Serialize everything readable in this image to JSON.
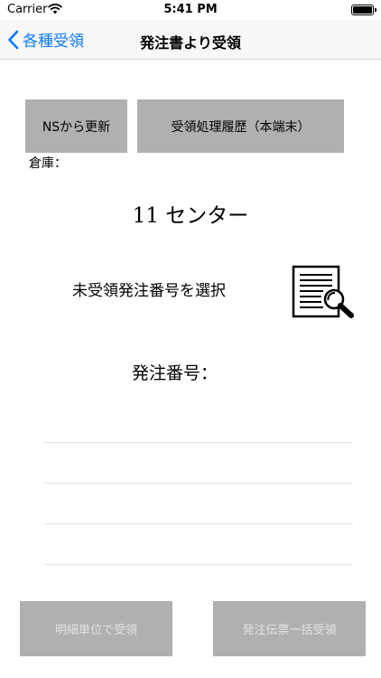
{
  "status": {
    "carrier": "Carrier",
    "time": "5:41 PM"
  },
  "nav": {
    "back_label": "各種受領",
    "title": "発注書より受領"
  },
  "actions": {
    "ns_update": "NSから更新",
    "history": "受領処理履歴（本端末）"
  },
  "warehouse": {
    "label": "倉庫：",
    "value": "11 センター"
  },
  "select_order": {
    "label": "未受領発注番号を選択",
    "icon": "search-document-icon"
  },
  "order_number": {
    "label": "発注番号：",
    "lines": [
      "",
      "",
      "",
      ""
    ]
  },
  "footer": {
    "detail_receive": "明細単位で受領",
    "bulk_receive": "発注伝票一括受領"
  },
  "colors": {
    "accent": "#0a7aff",
    "button_gray": "#b0b0b0",
    "disabled_text": "#e3e3e3"
  }
}
